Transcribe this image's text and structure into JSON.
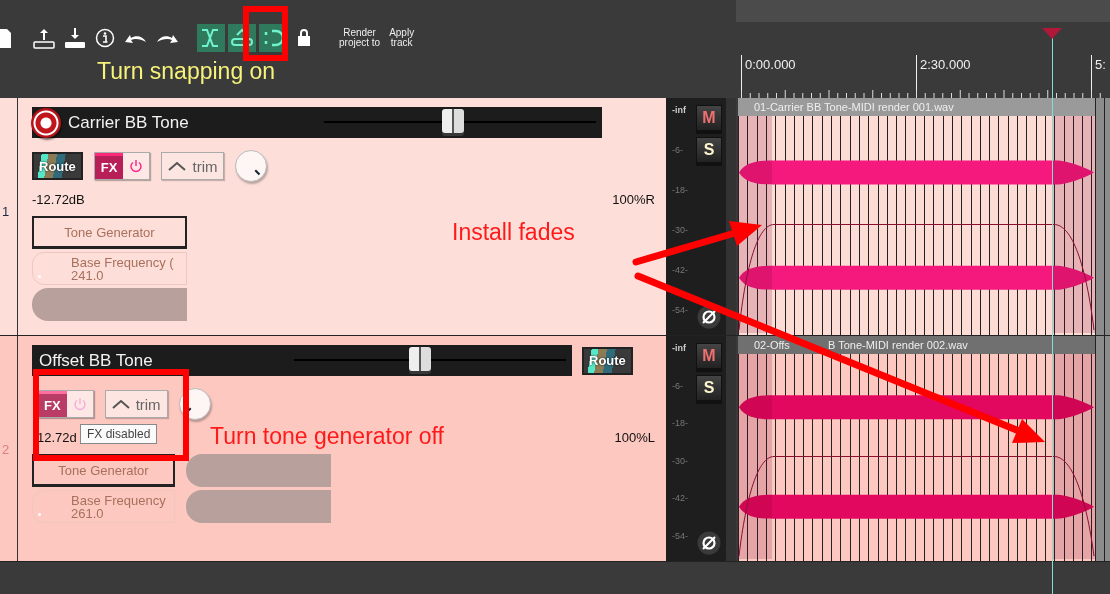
{
  "toolbar": {
    "toggles": [
      {
        "kind": "ripple",
        "on": true
      },
      {
        "kind": "group",
        "on": true
      },
      {
        "kind": "snap",
        "on": true
      }
    ],
    "text_buttons": [
      "Render\nproject to",
      "Apply\ntrack"
    ]
  },
  "tracks": [
    {
      "kind": "full",
      "number": "1",
      "selected": true,
      "name": "Carrier BB Tone",
      "record_armed": true,
      "fader": {
        "level": 0.47
      },
      "route": "Route",
      "fx": {
        "label": "FX",
        "enabled": true
      },
      "trim": "trim",
      "pan_knob": {
        "kind": "right"
      },
      "volume": "-12.72dB",
      "pan": "100%R",
      "params": [
        {
          "kind": "title",
          "label": "Tone Generator"
        },
        {
          "kind": "slider",
          "label": "Base Frequency (",
          "value": "241.0"
        },
        {
          "kind": "blank"
        }
      ],
      "meter": {
        "scale": [
          "-inf",
          "-6-",
          "-18-",
          "-30-",
          "-42-",
          "-54-"
        ],
        "mute": "M",
        "solo": "S"
      }
    },
    {
      "kind": "compact",
      "number": "2",
      "selected": false,
      "name": "Offset BB Tone",
      "record_armed": false,
      "fader": {
        "level": 0.46
      },
      "route": "Route",
      "fx": {
        "label": "FX",
        "enabled": false
      },
      "trim": "trim",
      "pan_knob": {
        "kind": "left"
      },
      "volume": "12.72d",
      "pan": "100%L",
      "tooltip": "FX disabled",
      "params": [
        {
          "kind": "title",
          "label": "Tone Generator"
        },
        {
          "kind": "blank"
        },
        {
          "kind": "slider",
          "label": "Base Frequency",
          "value": "261.0"
        },
        {
          "kind": "blank"
        }
      ],
      "meter": {
        "scale": [
          "-inf",
          "-6-",
          "-18-",
          "-30-",
          "-42-",
          "-54-"
        ],
        "mute": "M",
        "solo": "S"
      }
    }
  ],
  "timeline": {
    "ruler_labels": [
      "0:00.000",
      "2:30.000",
      "5:"
    ],
    "items": [
      {
        "name_fragments": [
          "01-Carrier BB Tone-MIDI render 001.wav"
        ],
        "selected": true,
        "color": "#f5197e"
      },
      {
        "name_fragments": [
          "02-Offs",
          "B Tone-MIDI render 002.wav"
        ],
        "selected": false,
        "color": "#e2085f"
      }
    ]
  },
  "annotations": [
    {
      "text": "Turn snapping on",
      "color": "#f7f27a"
    },
    {
      "text": "Install fades",
      "color": "#ff1a1a"
    },
    {
      "text": "Turn tone generator off",
      "color": "#ff1a1a"
    }
  ]
}
